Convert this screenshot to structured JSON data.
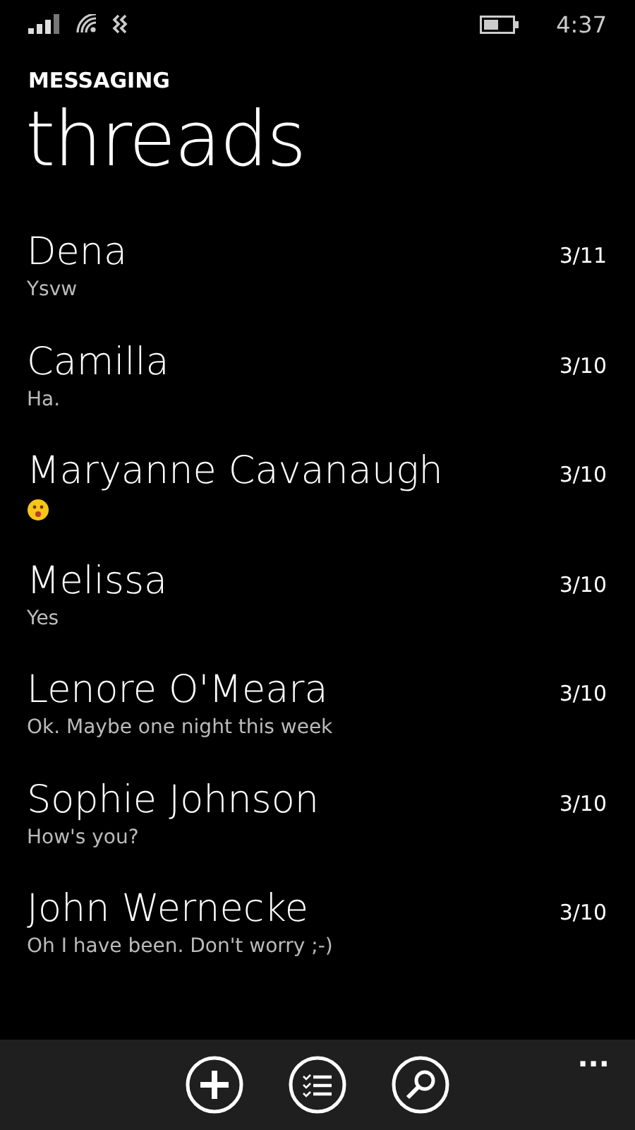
{
  "status_bar": {
    "time": "4:37"
  },
  "header": {
    "app": "MESSAGING",
    "title": "threads"
  },
  "threads": [
    {
      "name": "Dena",
      "kind": "text",
      "preview": "Ysvw",
      "date": "3/11"
    },
    {
      "name": "Camilla",
      "kind": "text",
      "preview": "Ha.",
      "date": "3/10"
    },
    {
      "name": "Maryanne Cavanaugh",
      "kind": "emoji",
      "date": "3/10"
    },
    {
      "name": "Melissa",
      "kind": "text",
      "preview": "Yes",
      "date": "3/10"
    },
    {
      "name": "Lenore O'Meara",
      "kind": "text",
      "preview": "Ok. Maybe one night this week",
      "date": "3/10"
    },
    {
      "name": "Sophie Johnson",
      "kind": "text",
      "preview": "How's you?",
      "date": "3/10"
    },
    {
      "name": "John Wernecke",
      "kind": "text",
      "preview": "Oh I have been. Don't worry ;-)",
      "date": "3/10"
    }
  ],
  "app_bar": {
    "more": "..."
  }
}
